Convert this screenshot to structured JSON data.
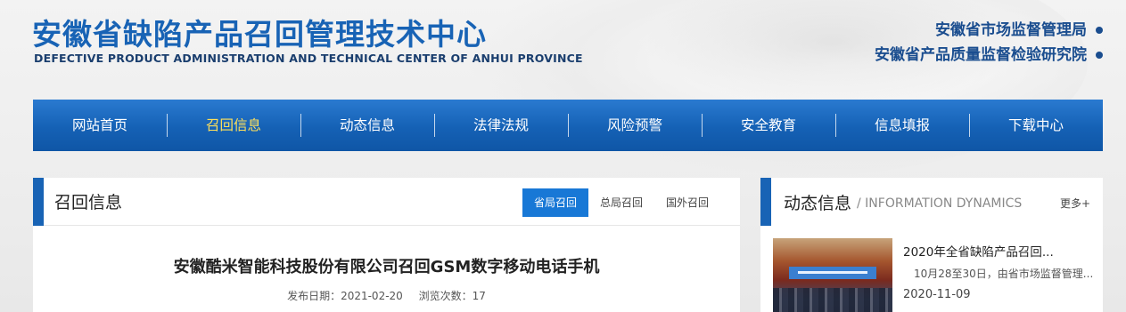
{
  "header": {
    "title": "安徽省缺陷产品召回管理技术中心",
    "subtitle": "DEFECTIVE PRODUCT ADMINISTRATION AND TECHNICAL CENTER OF ANHUI PROVINCE",
    "orgs": [
      "安徽省市场监督管理局",
      "安徽省产品质量监督检验研究院"
    ]
  },
  "nav": {
    "items": [
      "网站首页",
      "召回信息",
      "动态信息",
      "法律法规",
      "风险预警",
      "安全教育",
      "信息填报",
      "下载中心"
    ],
    "active_index": 1
  },
  "recall_panel": {
    "title": "召回信息",
    "tabs": [
      "省局召回",
      "总局召回",
      "国外召回"
    ],
    "active_tab": 0,
    "article": {
      "title": "安徽酷米智能科技股份有限公司召回GSM数字移动电话手机",
      "publish_label": "发布日期：2021-02-20",
      "views_label": "浏览次数：17"
    }
  },
  "news_panel": {
    "title": "动态信息",
    "subtitle": "/ INFORMATION DYNAMICS",
    "more": "更多+",
    "items": [
      {
        "title": "2020年全省缺陷产品召回...",
        "summary": "10月28至30日，由省市场监督管理...",
        "date": "2020-11-09"
      }
    ]
  },
  "colors": {
    "brand_blue": "#1863b5",
    "nav_active": "#ffe05a",
    "tab_active_bg": "#1878d6"
  }
}
